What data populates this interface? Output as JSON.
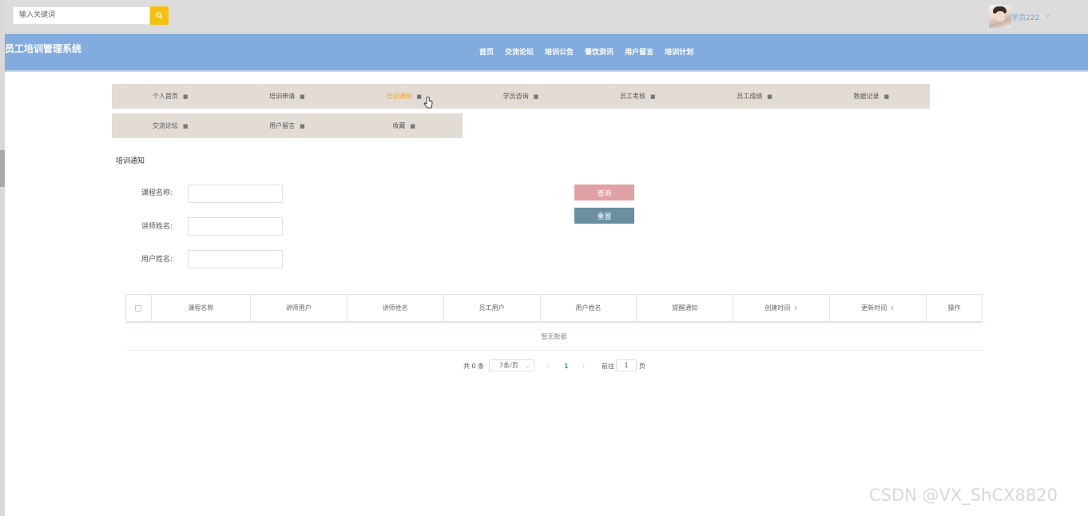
{
  "topbar": {
    "search_placeholder": "输入关键词",
    "user_name": "学员222",
    "user_caret": "⌄"
  },
  "header": {
    "system_title": "员工培训管理系统",
    "nav": [
      "首页",
      "交流论坛",
      "培训公告",
      "餐饮资讯",
      "用户留言",
      "培训计划"
    ]
  },
  "subnav": {
    "row1": [
      "个人首页",
      "培训申请",
      "培训通知",
      "学员咨询",
      "员工考核",
      "员工成绩",
      "数据记录"
    ],
    "row2": [
      "交流论坛",
      "用户留言",
      "收藏"
    ],
    "active": "培训通知"
  },
  "page": {
    "section_title": "培训通知"
  },
  "form": {
    "course_label": "课程名称:",
    "lecturer_label": "讲师姓名:",
    "user_label": "用户姓名:",
    "search_button": "查询",
    "reset_button": "重置"
  },
  "table": {
    "columns": [
      "课程名称",
      "讲师用户",
      "讲师姓名",
      "员工用户",
      "用户姓名",
      "提醒通知",
      "创建时间",
      "更新时间",
      "操作"
    ],
    "empty_text": "暂无数据"
  },
  "pagination": {
    "total": "共 0 条",
    "page_size": "7条/页",
    "current_page": "1",
    "goto_label": "前往",
    "goto_value": "1",
    "page_unit": "页"
  },
  "watermark": "CSDN @VX_ShCX8820",
  "colors": {
    "header_bg": "#82acdf",
    "search_btn": "#f3c012",
    "active_tab": "#f5a623",
    "query_btn": "#e0a0a4",
    "reset_btn": "#6a8fa0"
  }
}
